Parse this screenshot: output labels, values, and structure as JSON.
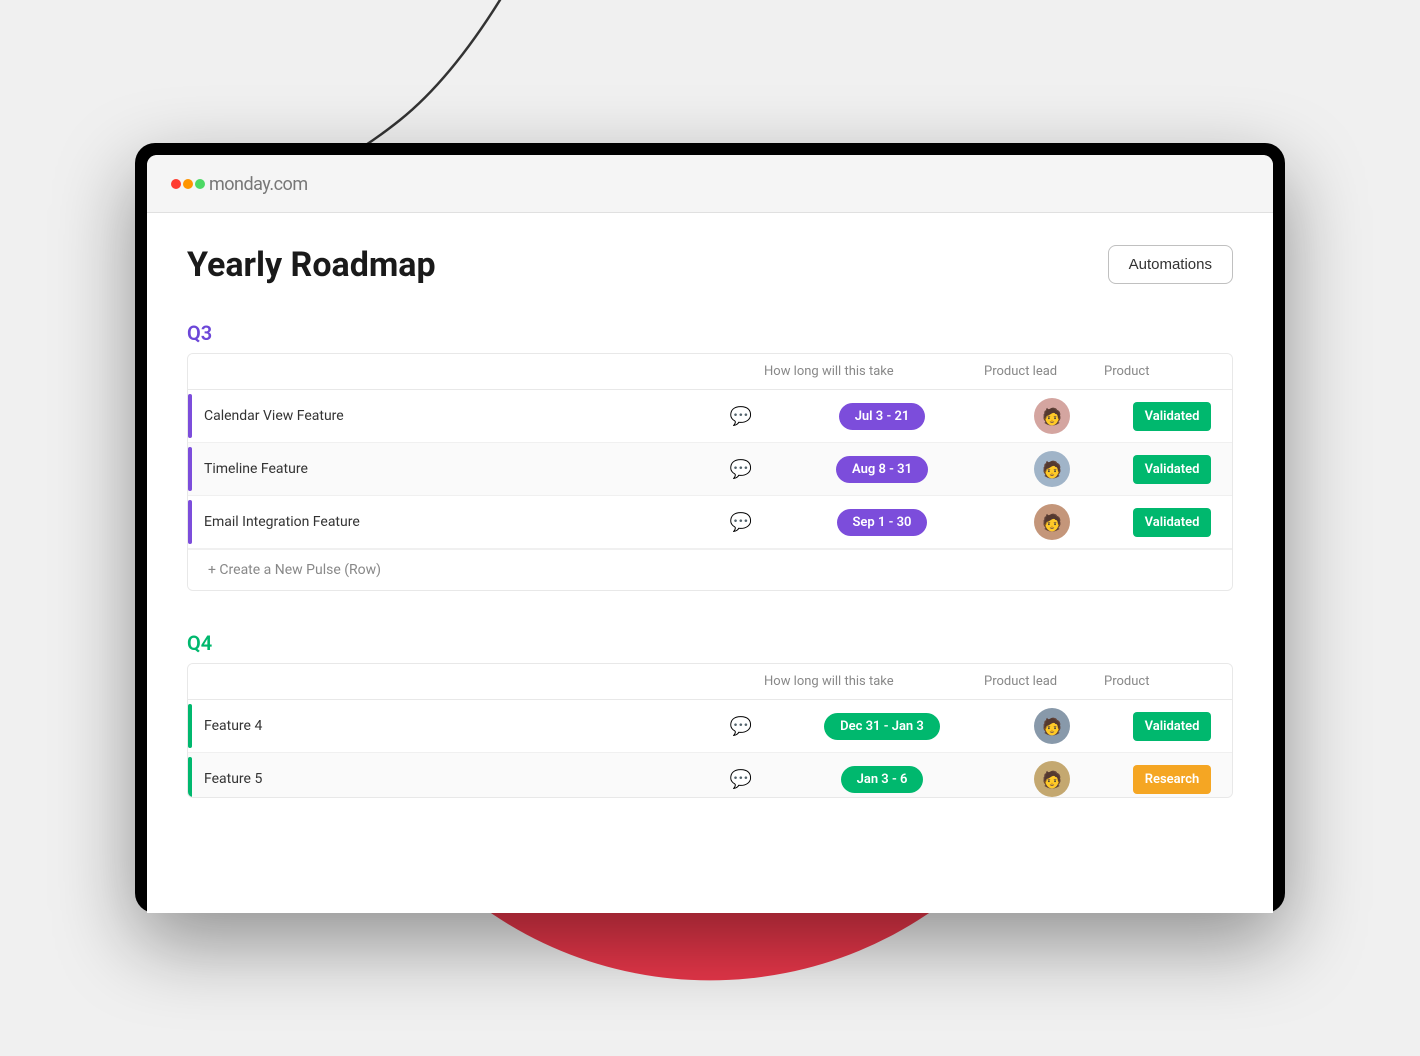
{
  "background": {
    "circle_color": "#e8374a"
  },
  "header": {
    "logo_brand": "monday",
    "logo_suffix": ".com",
    "dot_colors": [
      "#ff3b30",
      "#ff9500",
      "#34c759"
    ]
  },
  "page": {
    "title": "Yearly Roadmap",
    "automations_button": "Automations"
  },
  "q3_section": {
    "title": "Q3",
    "col_duration": "How long will this take",
    "col_lead": "Product lead",
    "col_product": "Product",
    "rows": [
      {
        "name": "Calendar View Feature",
        "border_color": "#7c4ddb",
        "date": "Jul 3 - 21",
        "date_color": "purple",
        "avatar_label": "👩",
        "status": "Validated",
        "status_color": "validated"
      },
      {
        "name": "Timeline Feature",
        "border_color": "#7c4ddb",
        "date": "Aug 8 - 31",
        "date_color": "purple",
        "avatar_label": "👨",
        "status": "Validated",
        "status_color": "validated"
      },
      {
        "name": "Email Integration Feature",
        "border_color": "#7c4ddb",
        "date": "Sep 1 - 30",
        "date_color": "purple",
        "avatar_label": "👩",
        "status": "Validated",
        "status_color": "validated"
      }
    ],
    "create_row_label": "+ Create a New Pulse (Row)"
  },
  "q4_section": {
    "title": "Q4",
    "col_duration": "How long will this take",
    "col_lead": "Product lead",
    "col_product": "Product",
    "rows": [
      {
        "name": "Feature 4",
        "border_color": "#00b86e",
        "date": "Dec 31 - Jan 3",
        "date_color": "green",
        "avatar_label": "👨",
        "status": "Validated",
        "status_color": "validated"
      },
      {
        "name": "Feature 5",
        "border_color": "#00b86e",
        "date": "Jan 3 - 6",
        "date_color": "green",
        "avatar_label": "👩",
        "status": "Research",
        "status_color": "research"
      }
    ]
  }
}
